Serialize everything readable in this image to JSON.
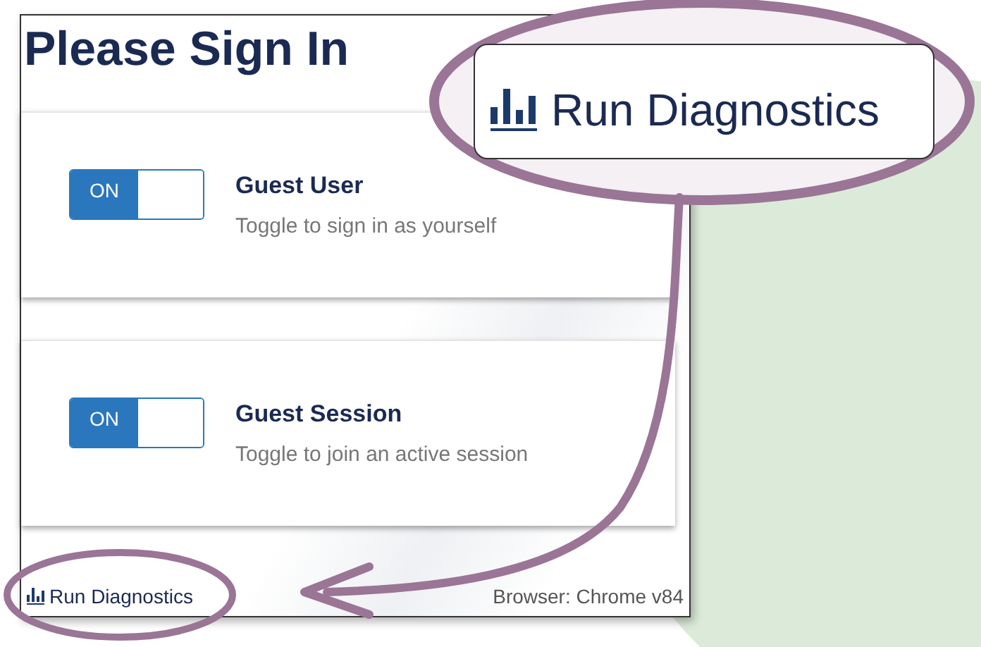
{
  "heading": "Please Sign In",
  "options": [
    {
      "title": "Guest User",
      "description": "Toggle to sign in as yourself",
      "toggle": {
        "label": "ON",
        "on": true
      }
    },
    {
      "title": "Guest Session",
      "description": "Toggle to join an active session",
      "toggle": {
        "label": "ON",
        "on": true
      }
    }
  ],
  "footer": {
    "diagnostics_link": "Run Diagnostics",
    "browser": "Browser: Chrome v84"
  },
  "callout": {
    "label": "Run Diagnostics"
  }
}
